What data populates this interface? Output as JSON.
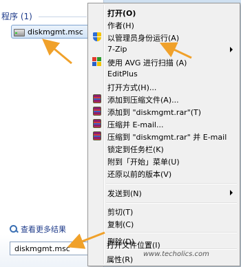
{
  "start_menu": {
    "group_header": "程序 (1)",
    "result_item": "diskmgmt.msc",
    "see_more": "查看更多结果",
    "search_value": "diskmgmt.msc"
  },
  "context_menu": {
    "items": [
      {
        "label": "打开(O)",
        "bold": true
      },
      {
        "label": "作者(H)"
      },
      {
        "label": "以管理员身份运行(A)",
        "icon": "uac-shield-icon"
      },
      {
        "label": "7-Zip",
        "submenu": true
      },
      {
        "label": "使用 AVG 进行扫描 (A)",
        "icon": "avg-icon"
      },
      {
        "label": "EditPlus"
      },
      {
        "label": "打开方式(H)..."
      },
      {
        "label": "添加到压缩文件(A)...",
        "icon": "winrar-icon"
      },
      {
        "label": "添加到 \"diskmgmt.rar\"(T)",
        "icon": "winrar-icon"
      },
      {
        "label": "压缩并 E-mail...",
        "icon": "winrar-icon"
      },
      {
        "label": "压缩到 \"diskmgmt.rar\" 并 E-mail",
        "icon": "winrar-icon"
      },
      {
        "label": "锁定到任务栏(K)"
      },
      {
        "label": "附到「开始」菜单(U)"
      },
      {
        "label": "还原以前的版本(V)"
      },
      {
        "label": "发送到(N)",
        "submenu": true
      },
      {
        "label": "剪切(T)"
      },
      {
        "label": "复制(C)"
      },
      {
        "label": "删除(D)"
      },
      {
        "label": "打开文件位置(I)"
      },
      {
        "label": "属性(R)"
      }
    ]
  },
  "watermark": "www.techolics.com",
  "colors": {
    "accent_blue": "#1e3b8a",
    "annotation_orange": "#f0a12a",
    "menu_bg": "#f0f0f0"
  }
}
